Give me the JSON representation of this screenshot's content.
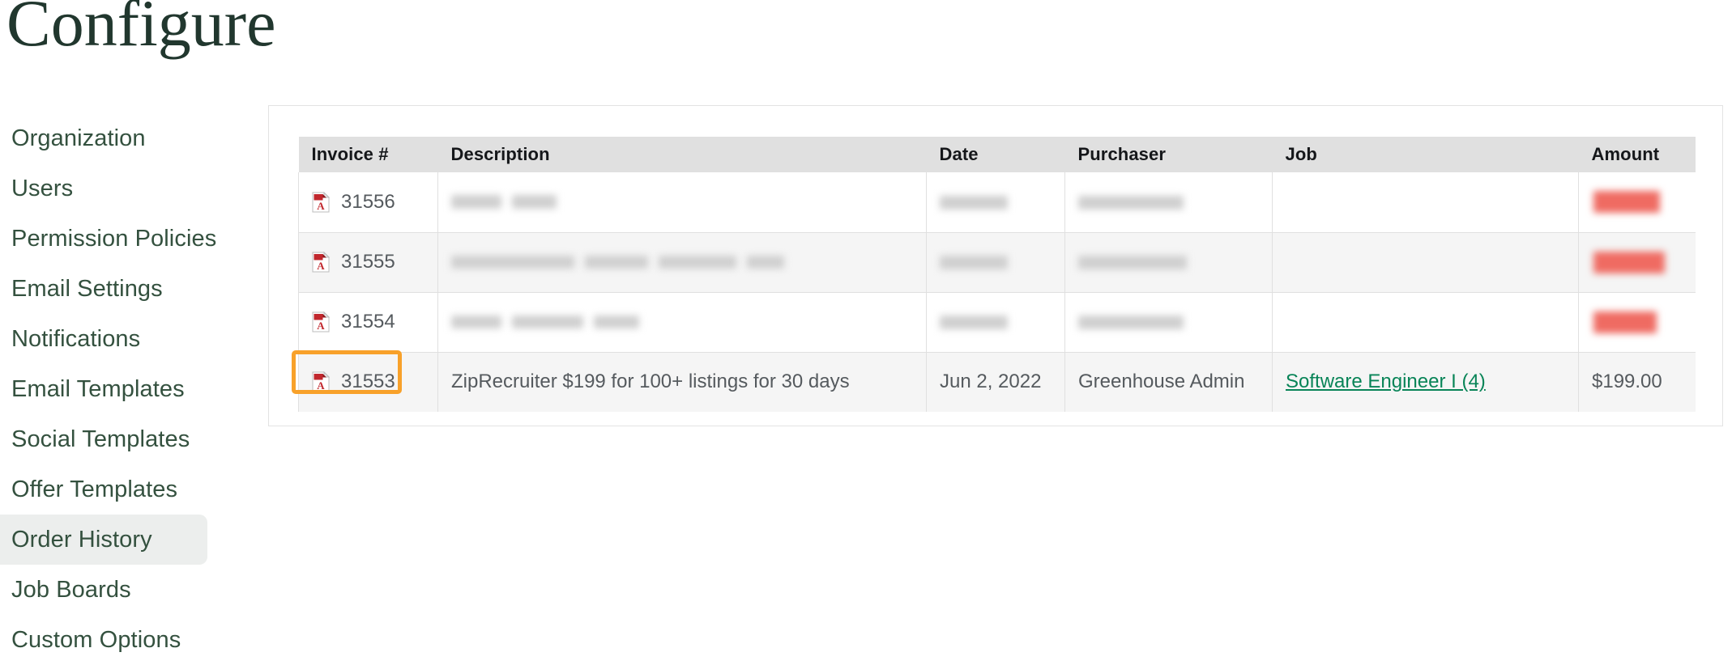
{
  "page": {
    "title": "Configure"
  },
  "sidebar": {
    "items": [
      {
        "label": "Organization",
        "active": false
      },
      {
        "label": "Users",
        "active": false
      },
      {
        "label": "Permission Policies",
        "active": false
      },
      {
        "label": "Email Settings",
        "active": false
      },
      {
        "label": "Notifications",
        "active": false
      },
      {
        "label": "Email Templates",
        "active": false
      },
      {
        "label": "Social Templates",
        "active": false
      },
      {
        "label": "Offer Templates",
        "active": false
      },
      {
        "label": "Order History",
        "active": true
      },
      {
        "label": "Job Boards",
        "active": false
      },
      {
        "label": "Custom Options",
        "active": false
      }
    ]
  },
  "table": {
    "columns": [
      "Invoice #",
      "Description",
      "Date",
      "Purchaser",
      "Job",
      "Amount"
    ],
    "rows": [
      {
        "invoice": "31556",
        "icon": "pdf-icon",
        "description": "",
        "date": "",
        "purchaser": "",
        "job": "",
        "amount": "",
        "redacted": true
      },
      {
        "invoice": "31555",
        "icon": "pdf-icon",
        "description": "",
        "date": "",
        "purchaser": "",
        "job": "",
        "amount": "",
        "redacted": true
      },
      {
        "invoice": "31554",
        "icon": "pdf-icon",
        "description": "",
        "date": "",
        "purchaser": "",
        "job": "",
        "amount": "",
        "redacted": true
      },
      {
        "invoice": "31553",
        "icon": "pdf-icon",
        "description": "ZipRecruiter $199 for 100+ listings for 30 days",
        "date": "Jun 2, 2022",
        "purchaser": "Greenhouse Admin",
        "job": "Software Engineer I (4)",
        "amount": "$199.00",
        "redacted": false
      }
    ]
  },
  "annotation": {
    "target_invoice": "31553",
    "color": "#f8a12a"
  },
  "colors": {
    "title": "#21372e",
    "sidebar_text": "#34513f",
    "sidebar_active_bg": "#eceeed",
    "header_bg": "#e0e0e0",
    "link_green": "#088457",
    "row_stripe": "#f5f5f5",
    "highlight_orange": "#f8a12a"
  }
}
